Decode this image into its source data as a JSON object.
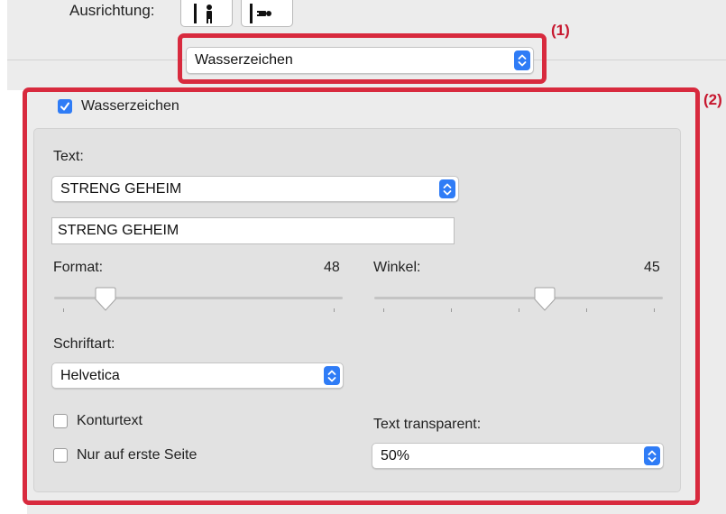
{
  "orientation": {
    "label": "Ausrichtung:",
    "portrait_icon": "portrait-orientation-icon",
    "landscape_icon": "landscape-orientation-icon"
  },
  "settings_popup": {
    "value": "Wasserzeichen"
  },
  "callouts": {
    "first": "(1)",
    "second": "(2)"
  },
  "watermark": {
    "enabled_label": "Wasserzeichen",
    "enabled": true,
    "text_label": "Text:",
    "text_preset": "STRENG GEHEIM",
    "text_value": "STRENG GEHEIM",
    "size_label": "Format:",
    "size_value": "48",
    "size_level": 0.15,
    "angle_label": "Winkel:",
    "angle_value": "45",
    "angle_level": 0.6,
    "font_label": "Schriftart:",
    "font_value": "Helvetica",
    "outline_label": "Konturtext",
    "outline_checked": false,
    "first_page_label": "Nur auf erste Seite",
    "first_page_checked": false,
    "transparency_label": "Text transparent:",
    "transparency_value": "50%"
  },
  "colors": {
    "accent": "#2f7cf6",
    "highlight": "#d82a3e",
    "panel": "#ececec",
    "group": "#e2e2e2"
  }
}
